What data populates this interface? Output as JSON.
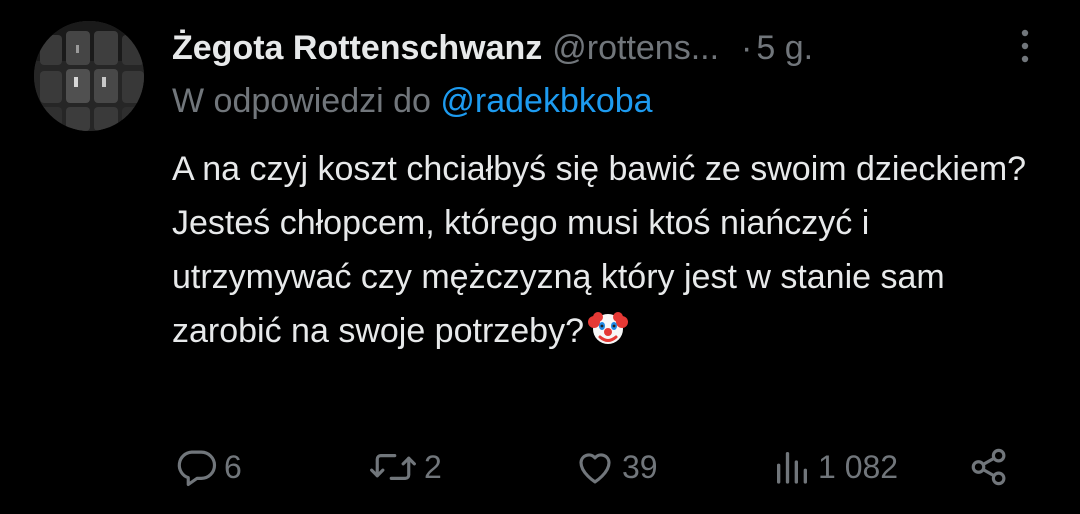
{
  "author": {
    "name": "Żegota Rottenschwanz",
    "handle": "@rottens...",
    "dot": "·",
    "time": "5 g."
  },
  "reply": {
    "prefix": "W odpowiedzi do",
    "mention": "@radekbkoba"
  },
  "tweet": {
    "text": "A na czyj koszt chciałbyś się bawić ze swoim dzieckiem? Jesteś chłopcem, którego musi ktoś niańczyć i utrzymywać czy mężczyzną który jest w stanie sam zarobić na swoje potrzeby?",
    "emoji": "clown-face"
  },
  "actions": {
    "replies": "6",
    "retweets": "2",
    "likes": "39",
    "views": "1 082"
  },
  "icons": {
    "more": "more-vertical-icon",
    "reply": "reply-icon",
    "retweet": "retweet-icon",
    "like": "heart-icon",
    "views": "views-icon",
    "share": "share-icon"
  },
  "colors": {
    "background": "#000000",
    "text": "#e7e9ea",
    "muted": "#71767b",
    "link": "#1d9bf0"
  }
}
